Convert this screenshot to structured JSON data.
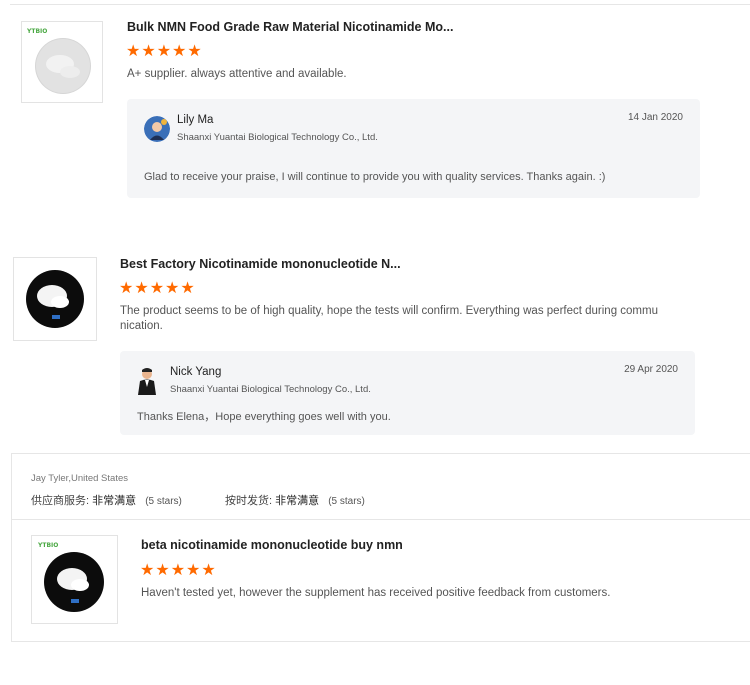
{
  "reviews": [
    {
      "product_title": "Bulk NMN Food Grade Raw Material Nicotinamide Mo...",
      "stars": "★★★★★",
      "review_text": "A+ supplier. always attentive and available.",
      "reply": {
        "name": "Lily Ma",
        "company": "Shaanxi Yuantai Biological Technology Co., Ltd.",
        "date": "14 Jan 2020",
        "text": "Glad to receive your praise, I will continue to provide you with quality services. Thanks again. :)"
      }
    },
    {
      "product_title": "Best Factory Nicotinamide mononucleotide N...",
      "stars": "★★★★★",
      "review_text": "The product seems to be of high quality, hope the tests will confirm. Everything was perfect during commu nication.",
      "reply": {
        "name": "Nick Yang",
        "company": "Shaanxi Yuantai Biological Technology Co., Ltd.",
        "date": "29 Apr 2020",
        "text": "Thanks Elena，Hope everything goes well with you."
      }
    },
    {
      "reviewer": "Jay Tyler,United States",
      "supplier_service_label": "供应商服务:",
      "supplier_service_value": "非常满意",
      "supplier_service_stars": "(5 stars)",
      "ontime_label": "按时发货:",
      "ontime_value": "非常满意",
      "ontime_stars": "(5 stars)",
      "product_title": "beta nicotinamide mononucleotide buy nmn",
      "stars": "★★★★★",
      "review_text": "Haven't tested yet, however the supplement has received positive feedback from customers."
    }
  ],
  "colors": {
    "star": "#ff6a00",
    "reply_bg": "#f4f5f7",
    "border": "#e3e3e3"
  },
  "icons": [
    "powder-product-image",
    "avatar-female-icon",
    "avatar-male-icon"
  ]
}
